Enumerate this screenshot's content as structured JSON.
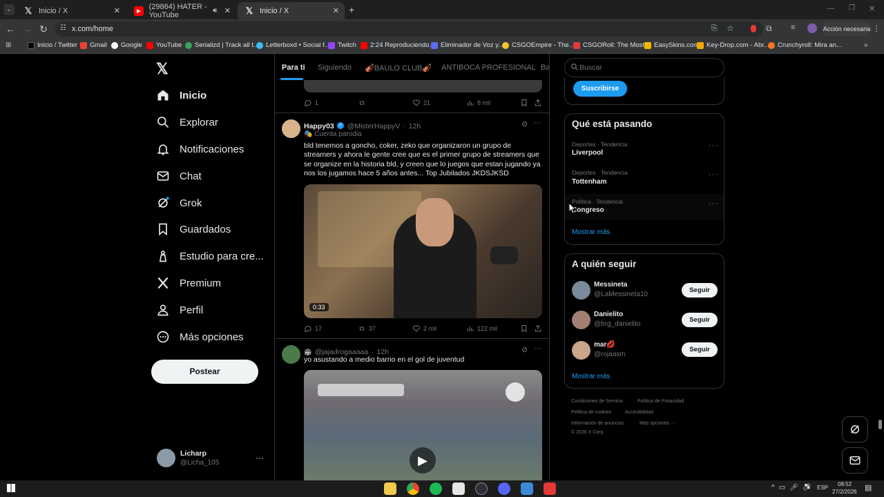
{
  "browser": {
    "tabs": [
      {
        "title": "Inicio / X"
      },
      {
        "title": "(29864) HATER - YouTube"
      },
      {
        "title": "Inicio / X"
      }
    ],
    "url": "x.com/home",
    "account_button": "Acción necesaria",
    "bookmarks": [
      "Inicio / Twitter",
      "Gmail",
      "Google",
      "YouTube",
      "Serializd | Track all t...",
      "Letterboxd • Social f...",
      "Twitch",
      "2:24 Reproduciendo...",
      "Eliminador de Voz y...",
      "CSGOEmpire - The...",
      "CSGORoll: The Most...",
      "EasySkins.com",
      "Key-Drop.com - Abr...",
      "Crunchyroll: Mira an..."
    ]
  },
  "nav": {
    "items": [
      "Inicio",
      "Explorar",
      "Notificaciones",
      "Chat",
      "Grok",
      "Guardados",
      "Estudio para cre...",
      "Premium",
      "Perfil",
      "Más opciones"
    ],
    "post_button": "Postear",
    "user": {
      "name": "Licharp",
      "handle": "@Licha_105"
    }
  },
  "feed": {
    "tabs": [
      "Para ti",
      "Siguiendo",
      "🎻BAULO CLUB🎻",
      "ANTIBOCA PROFESIONAL",
      "Ba"
    ],
    "top_actions": {
      "replies": "1",
      "likes": "21",
      "views": "8 mil"
    },
    "tweets": [
      {
        "name": "Happy03",
        "handle": "@MisterHappyV",
        "time": "12h",
        "label": "Cuenta parodia",
        "text": "bld tenemos a goncho, coker, zeko que organizaron un grupo de streamers y ahora le gente cree que es el primer grupo de streamers que se organize en la historia bld, y creen que lo juegos que estan jugando ya nos los jugamos hace 5 años antes... Top Jubilados JKDSJKSD",
        "video_time": "0:33",
        "replies": "17",
        "reposts": "37",
        "likes": "2 mil",
        "views": "122 mil"
      },
      {
        "handle": "@jajadrogaaaaa",
        "time": "12h",
        "text": "yo asustando a medio barrio en el gol de juventud"
      }
    ]
  },
  "sidebar": {
    "search_placeholder": "Buscar",
    "subscribe": "Suscribirse",
    "trends_title": "Qué está pasando",
    "trends": [
      {
        "meta": "Deportes · Tendencia",
        "name": "Liverpool"
      },
      {
        "meta": "Deportes · Tendencia",
        "name": "Tottenham"
      },
      {
        "meta": "Política · Tendencia",
        "name": "Congreso"
      }
    ],
    "show_more": "Mostrar más",
    "follow_title": "A quién seguir",
    "follow": [
      {
        "name": "Messineta",
        "handle": "@LaMessineta10",
        "button": "Seguir"
      },
      {
        "name": "Danielito",
        "handle": "@brg_danielito",
        "button": "Seguir"
      },
      {
        "name": "mar💋",
        "handle": "@rojaasm",
        "button": "Seguir"
      }
    ],
    "show_more_2": "Mostrar más",
    "footer": [
      "Condiciones de Servicio",
      "Política de Privacidad",
      "Política de cookies",
      "Accesibilidad",
      "Información de anuncios",
      "Más opciones ···",
      "© 2026 X Corp."
    ]
  },
  "taskbar": {
    "lang": "ESP",
    "time": "08:52",
    "date": "27/2/2026"
  },
  "colors": {
    "accent": "#1d9bf0",
    "background": "#000000",
    "border": "#2f3336",
    "muted": "#71767b"
  }
}
